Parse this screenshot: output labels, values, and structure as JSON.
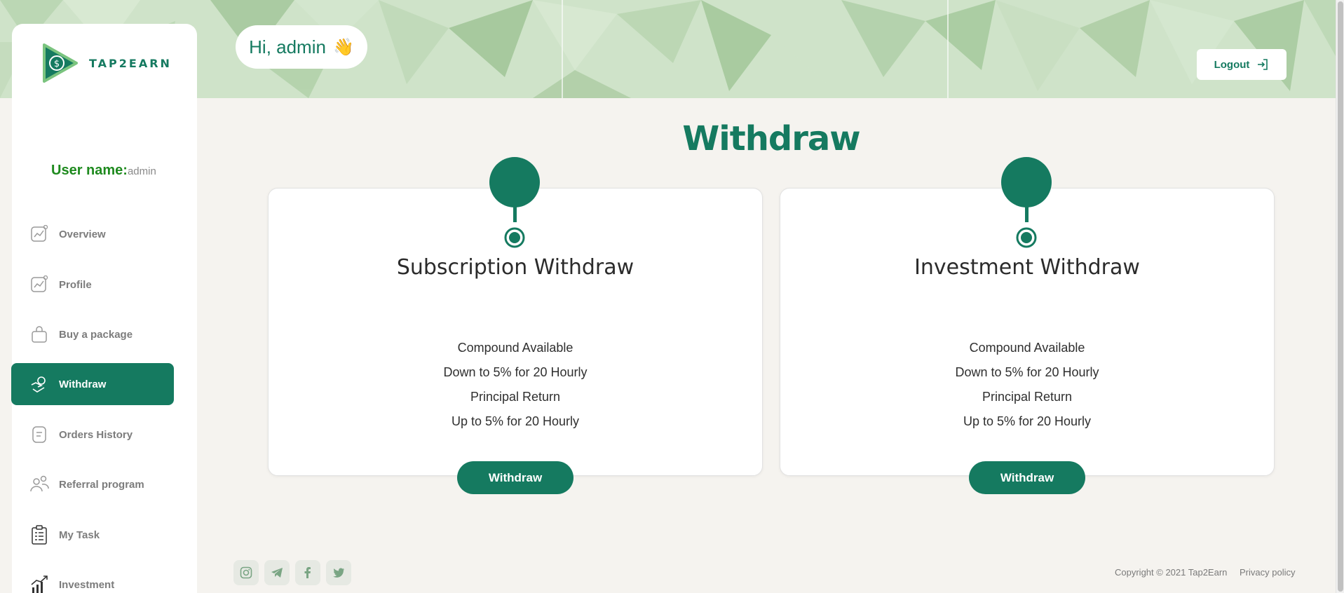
{
  "brand": {
    "name": "TAP2EARN"
  },
  "header": {
    "greeting": "Hi, admin",
    "greeting_emoji": "👋",
    "logout_label": "Logout"
  },
  "user": {
    "label": "User name:",
    "value": "admin"
  },
  "sidebar": {
    "items": [
      {
        "label": "Overview",
        "icon": "chart-icon",
        "active": false
      },
      {
        "label": "Profile",
        "icon": "chart-icon",
        "active": false
      },
      {
        "label": "Buy a package",
        "icon": "bag-icon",
        "active": false
      },
      {
        "label": "Withdraw",
        "icon": "money-hand-icon",
        "active": true
      },
      {
        "label": "Orders History",
        "icon": "document-icon",
        "active": false
      },
      {
        "label": "Referral program",
        "icon": "users-icon",
        "active": false
      },
      {
        "label": "My Task",
        "icon": "clipboard-icon",
        "active": false
      },
      {
        "label": "Investment",
        "icon": "growth-chart-icon",
        "active": false
      }
    ]
  },
  "main": {
    "title": "Withdraw",
    "cards": [
      {
        "title": "Subscription Withdraw",
        "features": [
          "Compound Available",
          "Down to 5% for 20 Hourly",
          "Principal Return",
          "Up to 5% for 20 Hourly"
        ],
        "button_label": "Withdraw"
      },
      {
        "title": "Investment Withdraw",
        "features": [
          "Compound Available",
          "Down to 5% for 20 Hourly",
          "Principal Return",
          "Up to 5% for 20 Hourly"
        ],
        "button_label": "Withdraw"
      }
    ]
  },
  "footer": {
    "socials": [
      "instagram-icon",
      "telegram-icon",
      "facebook-icon",
      "twitter-icon"
    ],
    "copyright": "Copyright © 2021 Tap2Earn",
    "privacy": "Privacy policy"
  },
  "colors": {
    "accent": "#157a60",
    "background": "#f5f3ef",
    "username_label": "#1e8a1e"
  }
}
